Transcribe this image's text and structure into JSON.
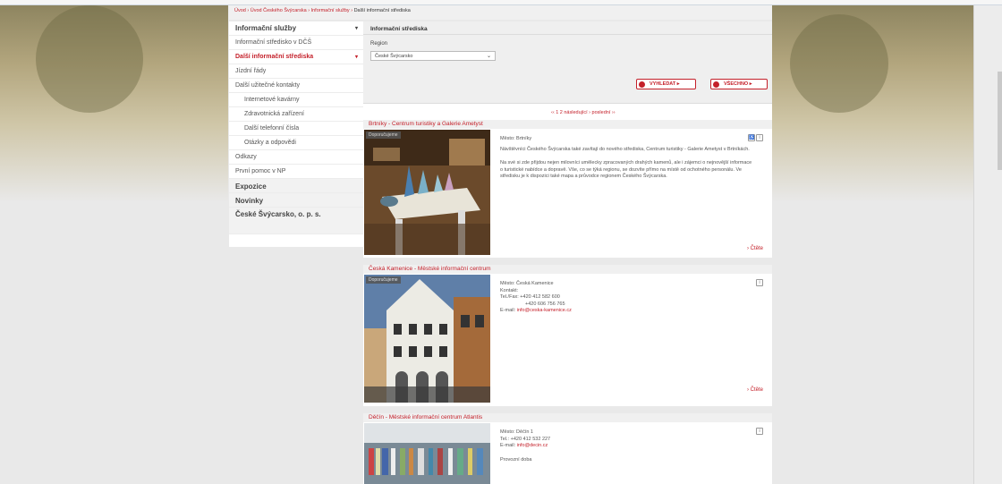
{
  "breadcrumb": {
    "links": "Úvod › Úvod Českého Švýcarska › Informační služby › ",
    "current": "Další informační střediska"
  },
  "sidebar": {
    "items": [
      {
        "label": "Informační služby",
        "arrow": "▾"
      },
      {
        "label": "Informační středisko v DČŠ"
      },
      {
        "label": "Další informační střediska",
        "arrow": "▾"
      },
      {
        "label": "Jízdní řády"
      },
      {
        "label": "Další užitečné kontakty"
      },
      {
        "label": "Internetové kavárny"
      },
      {
        "label": "Zdravotnická zařízení"
      },
      {
        "label": "Další telefonní čísla"
      },
      {
        "label": "Otázky a odpovědi"
      },
      {
        "label": "Odkazy"
      },
      {
        "label": "První pomoc v NP"
      },
      {
        "label": "Expozice"
      },
      {
        "label": "Novinky"
      },
      {
        "label": "České Švýcarsko, o. p. s."
      }
    ]
  },
  "panel": {
    "title": "Informační střediska",
    "region_label": "Region",
    "region_value": "České Švýcarsko",
    "search_button": "VYHLEDAT ▸",
    "all_button": "VŠECHNO ▸"
  },
  "pager": "‹‹ 1 2 následující › poslední ››",
  "cards": [
    {
      "title": "Brtníky - Centrum turistiky a Galerie Ametyst",
      "tag": "Doporučujeme",
      "place": "Město: Brtníky",
      "lines": [
        "Návštěvníci Českého Švýcarska také zavítají do nového střediska, Centrum turistiky - Galerie Ametyst v Brtníkách.",
        "Na své si zde přijdou nejen milovníci umělecky zpracovaných drahých kamenů, ale i zájemci o nejnovější informace o turistické nabídce a dopravě. Vše, co se týká regionu, se dozvíte přímo na místě od ochotného personálu. Ve středisku je k dispozici také mapa a průvodce regionem Českého Švýcarska."
      ],
      "more": "› Čtěte"
    },
    {
      "title": "Česká Kamenice - Městské informační centrum",
      "tag": "Doporučujeme",
      "lines": [
        "Město: Česká Kamenice",
        "Kontakt:",
        "Tel./Fax: +420 412 582 600",
        "+420 606 756 765"
      ],
      "email_label": "E-mail: ",
      "email": "info@ceska-kamenice.cz",
      "more": "› Čtěte"
    },
    {
      "title": "Děčín - Městské informační centrum Atlantis",
      "lines": [
        "Město: Děčín 1",
        "Tel.: +420 412 532 227"
      ],
      "email_label": "E-mail: ",
      "email": "info@decin.cz",
      "extra": "Provozní doba"
    }
  ]
}
